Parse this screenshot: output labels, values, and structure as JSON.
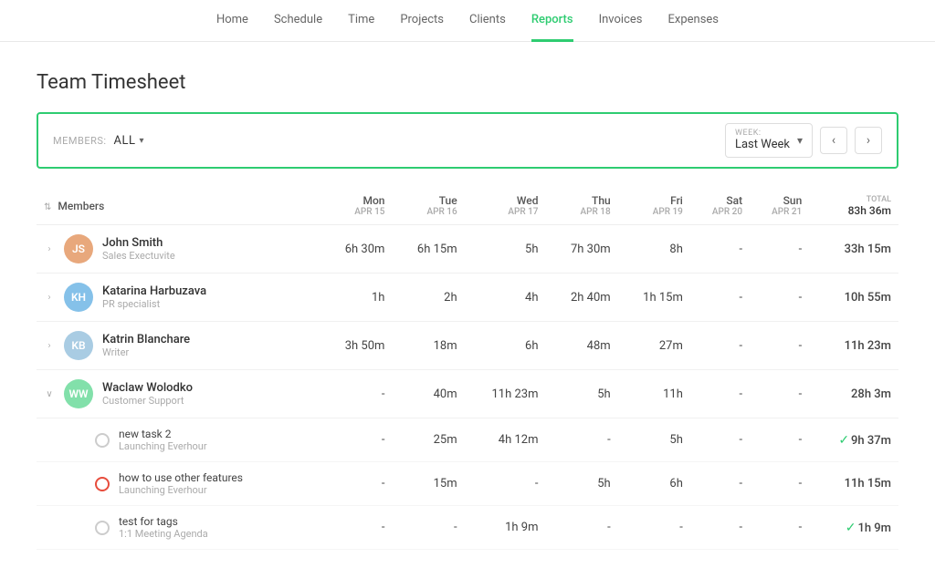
{
  "nav": {
    "items": [
      {
        "label": "Home",
        "active": false
      },
      {
        "label": "Schedule",
        "active": false
      },
      {
        "label": "Time",
        "active": false
      },
      {
        "label": "Projects",
        "active": false
      },
      {
        "label": "Clients",
        "active": false
      },
      {
        "label": "Reports",
        "active": true
      },
      {
        "label": "Invoices",
        "active": false
      },
      {
        "label": "Expenses",
        "active": false
      }
    ]
  },
  "page": {
    "title": "Team Timesheet"
  },
  "filter": {
    "members_label": "MEMBERS:",
    "members_value": "All",
    "week_label": "WEEK:",
    "week_value": "Last Week"
  },
  "table": {
    "member_col": "Members",
    "days": [
      {
        "name": "Mon",
        "date": "APR 15"
      },
      {
        "name": "Tue",
        "date": "APR 16"
      },
      {
        "name": "Wed",
        "date": "APR 17"
      },
      {
        "name": "Thu",
        "date": "APR 18"
      },
      {
        "name": "Fri",
        "date": "APR 19"
      },
      {
        "name": "Sat",
        "date": "APR 20"
      },
      {
        "name": "Sun",
        "date": "APR 21"
      }
    ],
    "total_label": "TOTAL",
    "total_value": "83h 36m",
    "members": [
      {
        "name": "John Smith",
        "role": "Sales Exectuvite",
        "initials": "JS",
        "avatar_class": "js",
        "expanded": false,
        "days": [
          "6h 30m",
          "6h 15m",
          "5h",
          "7h 30m",
          "8h",
          "-",
          "-"
        ],
        "total": "33h 15m"
      },
      {
        "name": "Katarina Harbuzava",
        "role": "PR specialist",
        "initials": "KH",
        "avatar_class": "kh",
        "expanded": false,
        "days": [
          "1h",
          "2h",
          "4h",
          "2h 40m",
          "1h 15m",
          "-",
          "-"
        ],
        "total": "10h 55m"
      },
      {
        "name": "Katrin Blanchare",
        "role": "Writer",
        "initials": "KB",
        "avatar_class": "kb",
        "expanded": false,
        "days": [
          "3h 50m",
          "18m",
          "6h",
          "48m",
          "27m",
          "-",
          "-"
        ],
        "total": "11h 23m"
      },
      {
        "name": "Waclaw Wolodko",
        "role": "Customer Support",
        "initials": "WW",
        "avatar_class": "ww",
        "expanded": true,
        "days": [
          "-",
          "40m",
          "11h 23m",
          "5h",
          "11h",
          "-",
          "-"
        ],
        "total": "28h 3m"
      }
    ],
    "tasks": [
      {
        "name": "new task 2",
        "project": "Launching Everhour",
        "status": "circle",
        "status_type": "gray",
        "days": [
          "-",
          "25m",
          "4h 12m",
          "-",
          "5h",
          "-",
          "-"
        ],
        "total": "9h 37m",
        "has_icon": true
      },
      {
        "name": "how to use other features",
        "project": "Launching Everhour",
        "status": "circle",
        "status_type": "red",
        "days": [
          "-",
          "15m",
          "-",
          "5h",
          "6h",
          "-",
          "-"
        ],
        "total": "11h 15m",
        "has_icon": false
      },
      {
        "name": "test for tags",
        "project": "1:1 Meeting Agenda",
        "status": "circle",
        "status_type": "gray",
        "days": [
          "-",
          "-",
          "1h 9m",
          "-",
          "-",
          "-",
          "-"
        ],
        "total": "1h 9m",
        "has_icon": true
      }
    ]
  }
}
